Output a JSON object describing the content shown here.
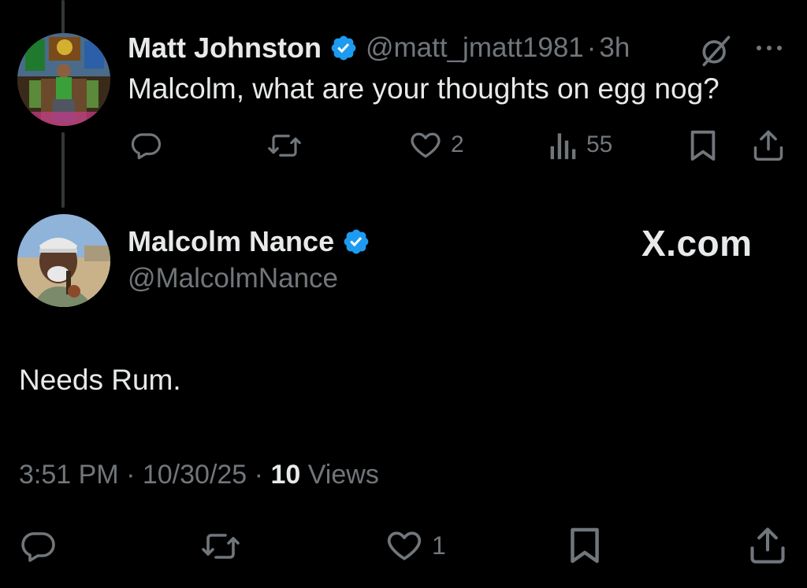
{
  "parent_tweet": {
    "author_name": "Matt Johnston",
    "handle": "@matt_jmatt1981",
    "separator": "·",
    "time_ago": "3h",
    "text": "Malcolm, what are your thoughts on egg nog?",
    "like_count": "2",
    "view_count": "55"
  },
  "main_tweet": {
    "author_name": "Malcolm Nance",
    "handle": "@MalcolmNance",
    "watermark": "X.com",
    "text": "Needs Rum.",
    "time": "3:51 PM",
    "date": "10/30/25",
    "separator": "·",
    "view_count": "10",
    "views_label": "Views",
    "like_count": "1"
  },
  "colors": {
    "background": "#000000",
    "text_primary": "#e7e9ea",
    "text_secondary": "#71767b",
    "verified_blue": "#1d9bf0"
  },
  "icons": [
    "reply-icon",
    "repost-icon",
    "like-icon",
    "views-icon",
    "bookmark-icon",
    "share-icon",
    "verified-badge-icon",
    "grok-icon",
    "more-icon"
  ]
}
